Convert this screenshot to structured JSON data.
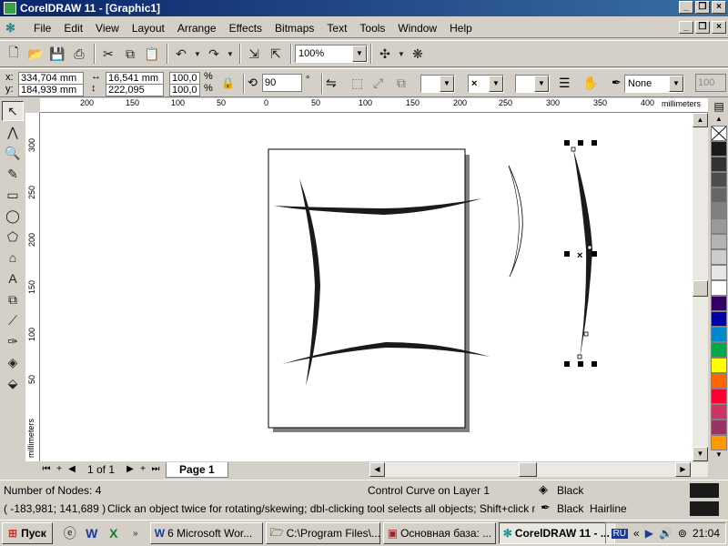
{
  "window": {
    "title": "CorelDRAW 11 - [Graphic1]",
    "minimize": "_",
    "maximize": "❐",
    "close": "×"
  },
  "menu": {
    "items": [
      "File",
      "Edit",
      "View",
      "Layout",
      "Arrange",
      "Effects",
      "Bitmaps",
      "Text",
      "Tools",
      "Window",
      "Help"
    ]
  },
  "toolbar": {
    "zoom_value": "100%"
  },
  "property_bar": {
    "x_label": "x:",
    "y_label": "y:",
    "x_value": "334,704 mm",
    "y_value": "184,939 mm",
    "width_value": "16,541 mm",
    "height_value": "222,095 mm",
    "scale_x": "100,0",
    "scale_y": "100,0",
    "percent": "%",
    "rotation": "90",
    "degree": "°",
    "outline_width": "None",
    "right_value": "100"
  },
  "rulers": {
    "units": "millimeters",
    "h_ticks": [
      "200",
      "150",
      "100",
      "50",
      "0",
      "50",
      "100",
      "150",
      "200",
      "250",
      "300",
      "350",
      "400"
    ],
    "v_ticks": [
      "300",
      "250",
      "200",
      "150",
      "100",
      "50"
    ]
  },
  "palette": {
    "colors": [
      "#ffffff",
      "#1a1a1a",
      "#333333",
      "#4d4d4d",
      "#666666",
      "#808080",
      "#999999",
      "#b3b3b3",
      "#cccccc",
      "#e6e6e6",
      "#ffffff",
      "#330066",
      "#0000aa",
      "#0088cc",
      "#00aa44",
      "#ffff00",
      "#ff6600",
      "#ff0033",
      "#cc3366",
      "#993366",
      "#ff9900"
    ]
  },
  "pagebar": {
    "page_count": "1 of 1",
    "tab_label": "Page 1"
  },
  "status": {
    "nodes": "Number of Nodes: 4",
    "layer": "Control Curve on Layer 1",
    "fill_label": "Black",
    "outline_label": "Black  Hairline",
    "coords": "( -183,981; 141,689 )",
    "hint": "Click an object twice for rotating/skewing; dbl-clicking tool selects all objects; Shift+click multi-sele..."
  },
  "taskbar": {
    "start": "Пуск",
    "tasks": [
      "6 Microsoft Wor...",
      "C:\\Program Files\\...",
      "Основная база: ...",
      "CorelDRAW 11 - ..."
    ],
    "lang": "RU",
    "clock": "21:04"
  }
}
